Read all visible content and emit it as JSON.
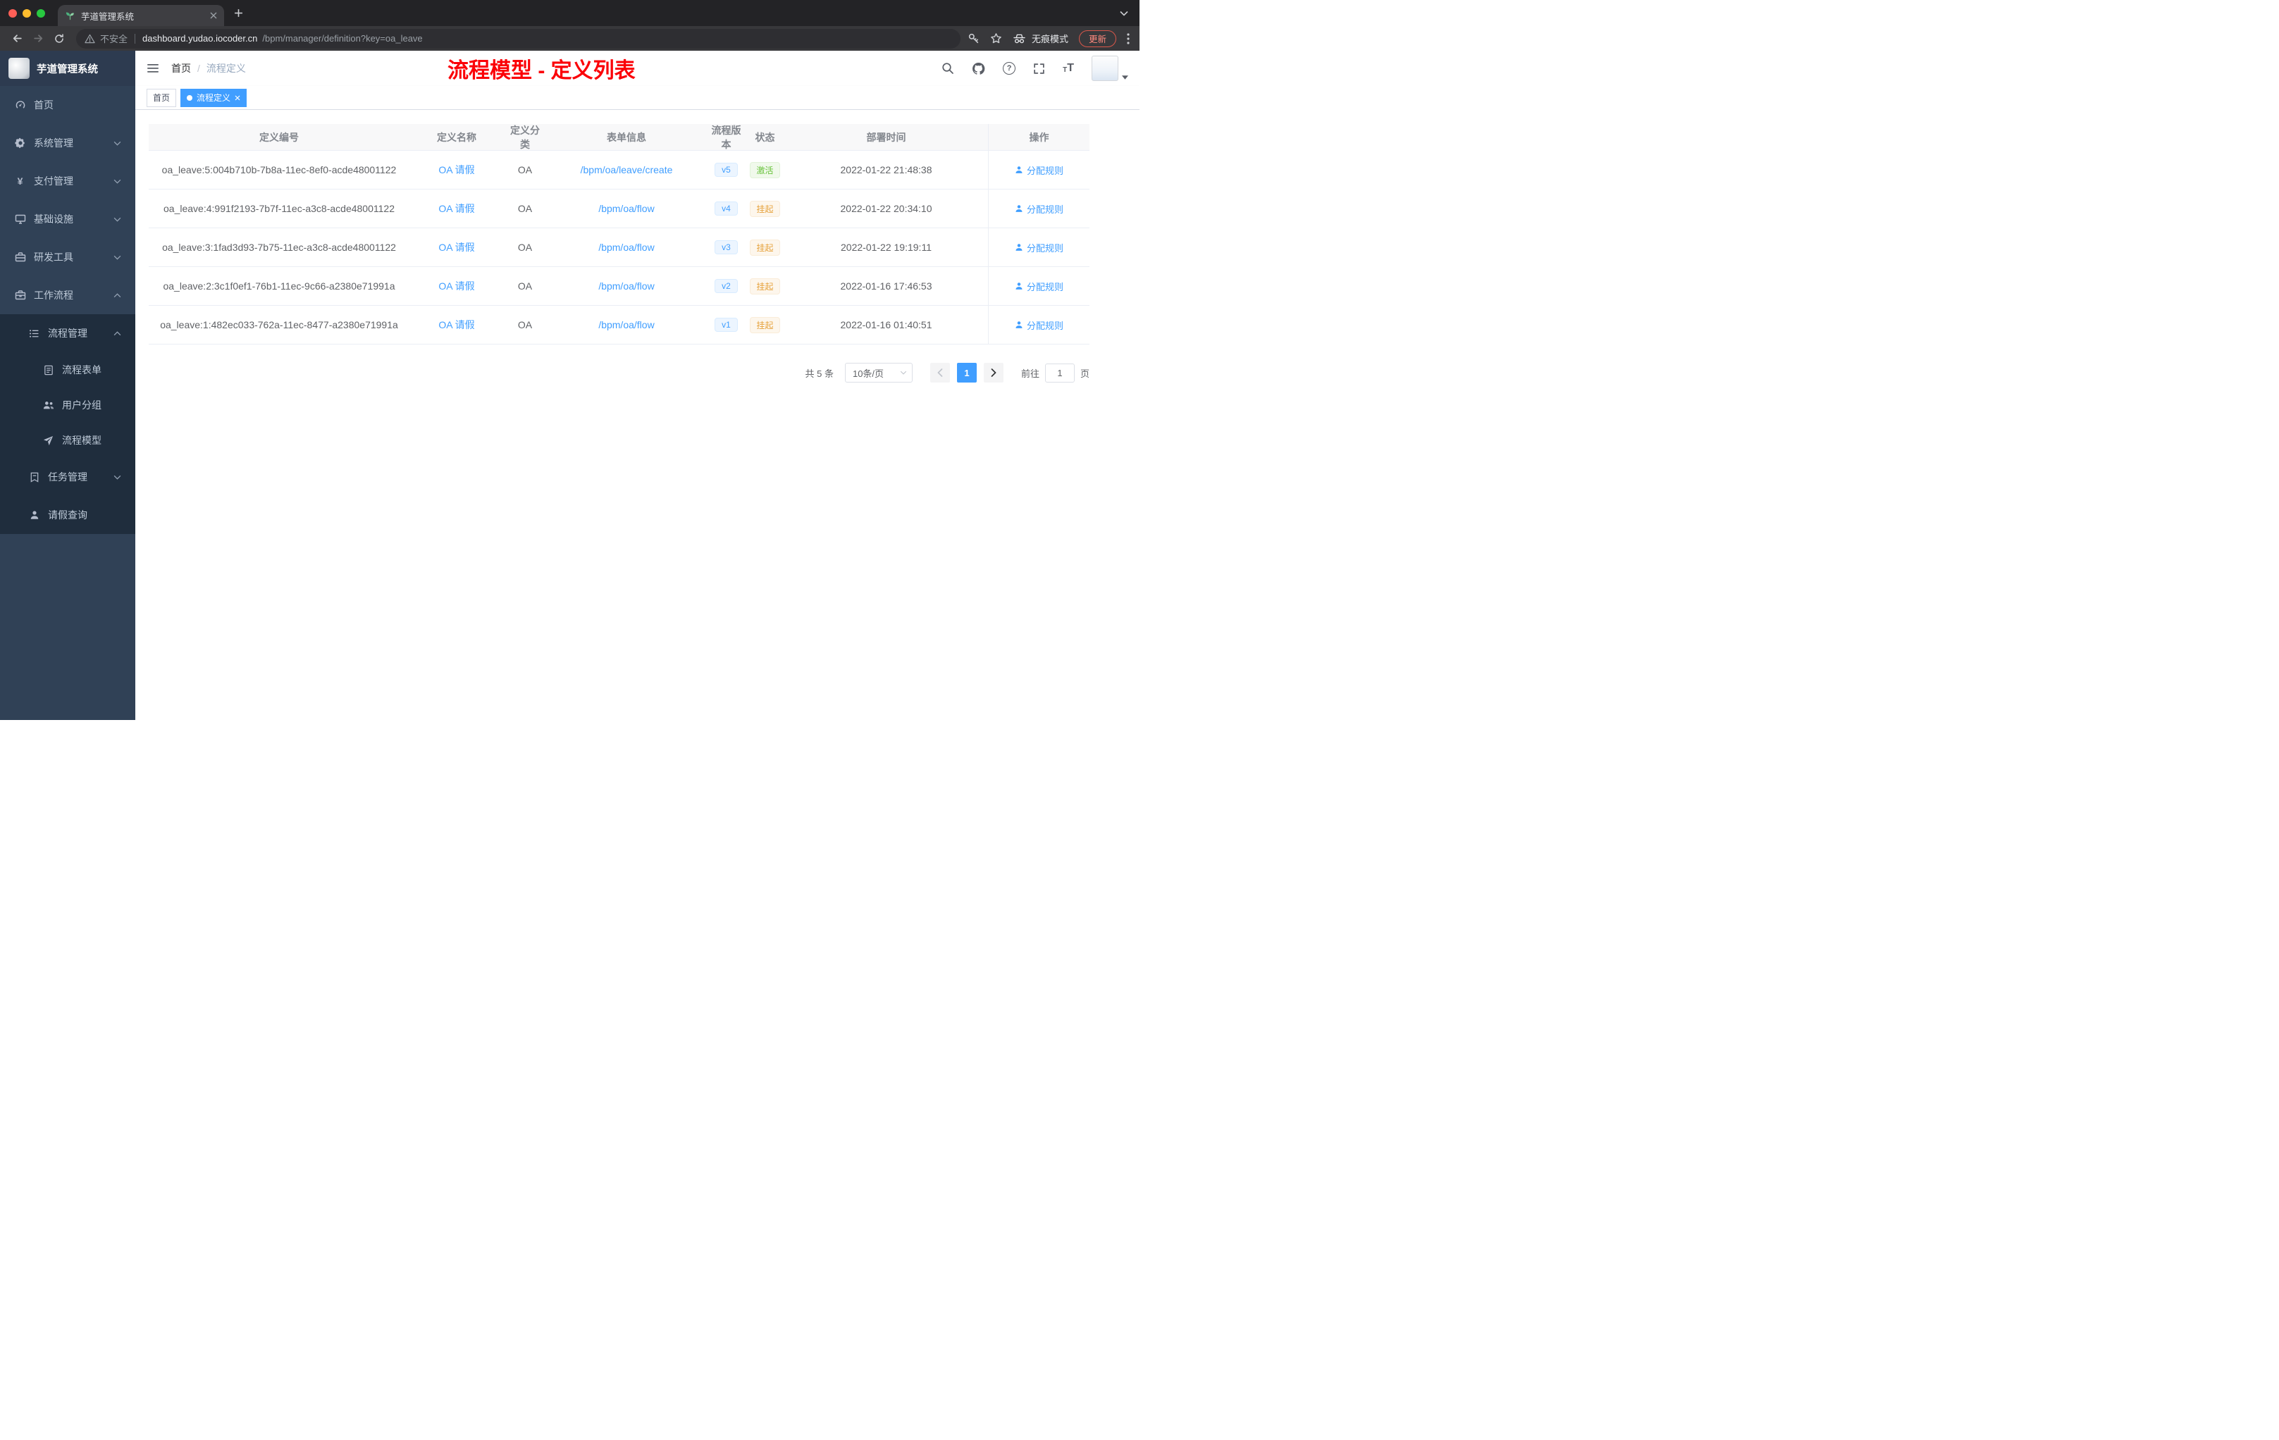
{
  "theme": {
    "accent": "#409eff",
    "success": "#67c23a",
    "warning": "#e6a23c",
    "annotation_red": "#fb0007",
    "sidebar_bg": "#304156",
    "submenu_bg": "#1f2d3d"
  },
  "browser": {
    "tab_title": "芋道管理系统",
    "security_label": "不安全",
    "url_domain": "dashboard.yudao.iocoder.cn",
    "url_path": "/bpm/manager/definition?key=oa_leave",
    "incognito_label": "无痕模式",
    "update_label": "更新"
  },
  "sidebar": {
    "logo_title": "芋道管理系统",
    "items": [
      {
        "label": "首页",
        "icon": "dashboard-icon"
      },
      {
        "label": "系统管理",
        "icon": "gear-icon",
        "chevron": "down"
      },
      {
        "label": "支付管理",
        "icon": "yen-icon",
        "chevron": "down",
        "glyph": "¥"
      },
      {
        "label": "基础设施",
        "icon": "monitor-icon",
        "chevron": "down"
      },
      {
        "label": "研发工具",
        "icon": "toolbox-icon",
        "chevron": "down"
      },
      {
        "label": "工作流程",
        "icon": "briefcase-icon",
        "chevron": "up"
      },
      {
        "label": "流程管理",
        "icon": "list-icon",
        "chevron": "up"
      },
      {
        "label": "流程表单",
        "icon": "form-icon"
      },
      {
        "label": "用户分组",
        "icon": "user-group-icon"
      },
      {
        "label": "流程模型",
        "icon": "send-icon"
      },
      {
        "label": "任务管理",
        "icon": "task-icon",
        "chevron": "down"
      },
      {
        "label": "请假查询",
        "icon": "user-icon"
      }
    ]
  },
  "topbar": {
    "breadcrumb": {
      "home": "首页",
      "separator": "/",
      "current": "流程定义"
    },
    "annotation": "流程模型 - 定义列表",
    "help_glyph": "?",
    "fontsize_glyph": "T",
    "icons": [
      "search-icon",
      "github-icon",
      "help-icon",
      "fullscreen-icon",
      "font-size-icon"
    ]
  },
  "tags": [
    {
      "label": "首页",
      "active": false
    },
    {
      "label": "流程定义",
      "active": true
    }
  ],
  "table": {
    "columns": [
      "定义编号",
      "定义名称",
      "定义分类",
      "表单信息",
      "流程版本",
      "状态",
      "部署时间",
      "操作"
    ],
    "rows": [
      {
        "id": "oa_leave:5:004b710b-7b8a-11ec-8ef0-acde48001122",
        "name": "OA 请假",
        "category": "OA",
        "form": "/bpm/oa/leave/create",
        "version": "v5",
        "status": "激活",
        "status_type": "success",
        "deploy_time": "2022-01-22 21:48:38",
        "action": "分配规则"
      },
      {
        "id": "oa_leave:4:991f2193-7b7f-11ec-a3c8-acde48001122",
        "name": "OA 请假",
        "category": "OA",
        "form": "/bpm/oa/flow",
        "version": "v4",
        "status": "挂起",
        "status_type": "warning",
        "deploy_time": "2022-01-22 20:34:10",
        "action": "分配规则"
      },
      {
        "id": "oa_leave:3:1fad3d93-7b75-11ec-a3c8-acde48001122",
        "name": "OA 请假",
        "category": "OA",
        "form": "/bpm/oa/flow",
        "version": "v3",
        "status": "挂起",
        "status_type": "warning",
        "deploy_time": "2022-01-22 19:19:11",
        "action": "分配规则"
      },
      {
        "id": "oa_leave:2:3c1f0ef1-76b1-11ec-9c66-a2380e71991a",
        "name": "OA 请假",
        "category": "OA",
        "form": "/bpm/oa/flow",
        "version": "v2",
        "status": "挂起",
        "status_type": "warning",
        "deploy_time": "2022-01-16 17:46:53",
        "action": "分配规则"
      },
      {
        "id": "oa_leave:1:482ec033-762a-11ec-8477-a2380e71991a",
        "name": "OA 请假",
        "category": "OA",
        "form": "/bpm/oa/flow",
        "version": "v1",
        "status": "挂起",
        "status_type": "warning",
        "deploy_time": "2022-01-16 01:40:51",
        "action": "分配规则"
      }
    ]
  },
  "pagination": {
    "total_label": "共 5 条",
    "page_size_label": "10条/页",
    "current_page": "1",
    "goto_label": "前往",
    "goto_value": "1",
    "page_suffix": "页"
  }
}
